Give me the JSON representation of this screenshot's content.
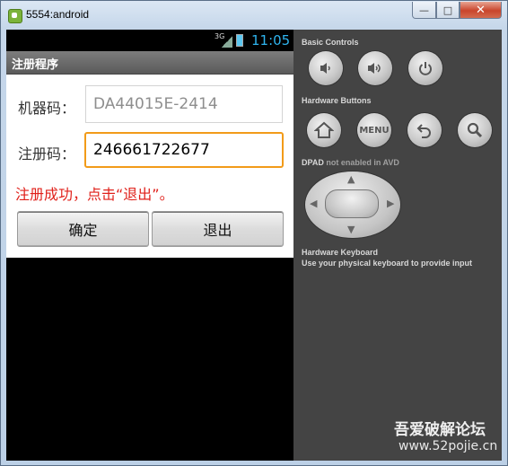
{
  "window": {
    "title": "5554:android",
    "minimize_glyph": "—",
    "maximize_glyph": "□",
    "close_glyph": "✕"
  },
  "statusbar": {
    "network": "3G",
    "time": "11:05"
  },
  "app": {
    "title": "注册程序",
    "machine_code_label": "机器码：",
    "machine_code_value": "DA44015E-2414",
    "reg_code_label": "注册码：",
    "reg_code_value": "246661722677",
    "status_message": "注册成功，点击“退出”。",
    "ok_button": "确定",
    "exit_button": "退出"
  },
  "controls": {
    "basic_title": "Basic Controls",
    "hardware_title": "Hardware Buttons",
    "menu_label": "MENU",
    "dpad_title": "DPAD",
    "dpad_note": "not enabled in AVD",
    "keyboard_title": "Hardware Keyboard",
    "keyboard_note": "Use your physical keyboard to provide input",
    "icons": [
      "volume-down-icon",
      "volume-up-icon",
      "power-icon",
      "home-icon",
      "menu-icon",
      "back-icon",
      "search-icon"
    ]
  },
  "watermark": {
    "line1": "吾爱破解论坛",
    "line2": "www.52pojie.cn"
  }
}
